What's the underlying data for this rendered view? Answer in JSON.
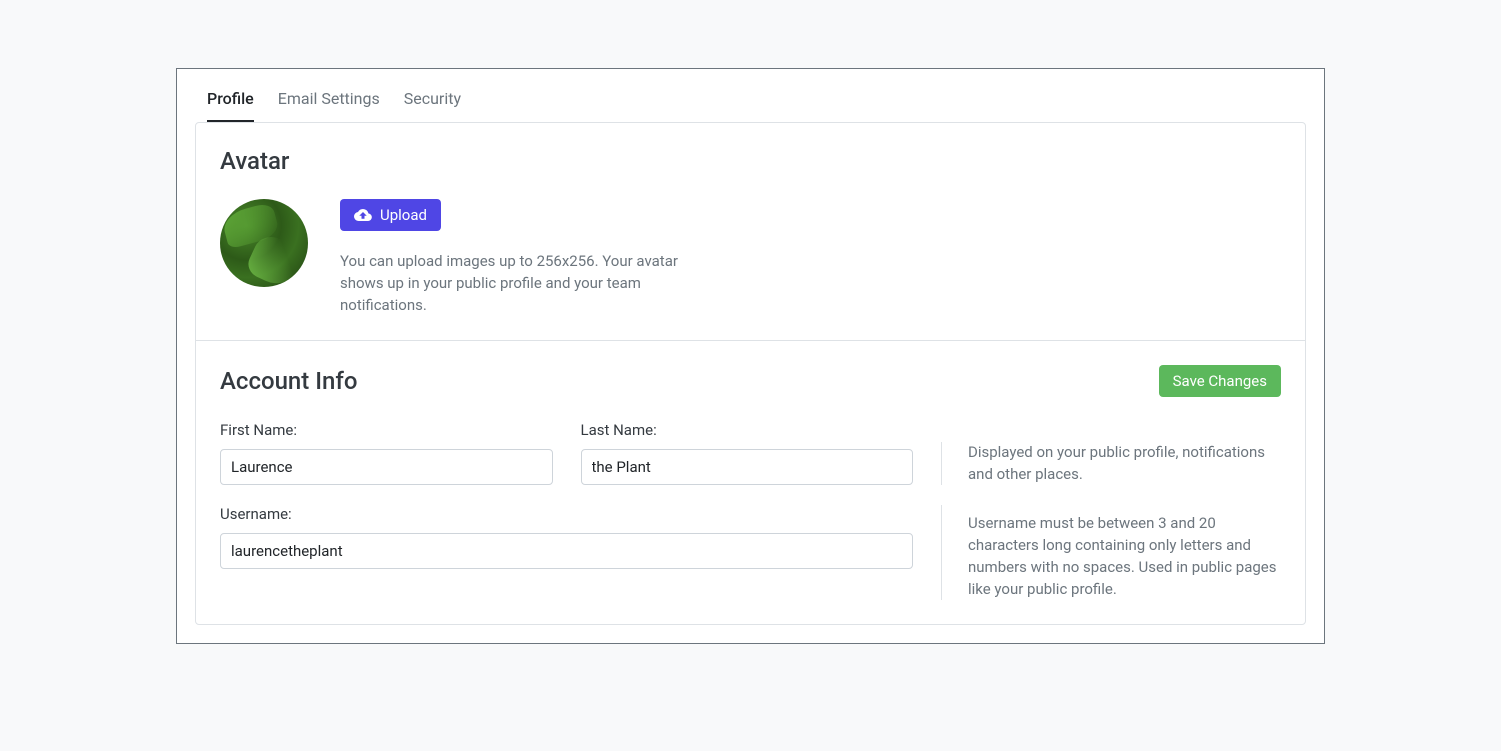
{
  "tabs": [
    {
      "label": "Profile",
      "active": true
    },
    {
      "label": "Email Settings",
      "active": false
    },
    {
      "label": "Security",
      "active": false
    }
  ],
  "avatar_section": {
    "title": "Avatar",
    "upload_label": "Upload",
    "help_text": "You can upload images up to 256x256. Your avatar shows up in your public profile and your team notifications."
  },
  "account_section": {
    "title": "Account Info",
    "save_label": "Save Changes",
    "fields": {
      "first_name": {
        "label": "First Name:",
        "value": "Laurence"
      },
      "last_name": {
        "label": "Last Name:",
        "value": "the Plant"
      },
      "username": {
        "label": "Username:",
        "value": "laurencetheplant"
      }
    },
    "hints": {
      "name": "Displayed on your public profile, notifications and other places.",
      "username": "Username must be between 3 and 20 characters long containing only letters and numbers with no spaces. Used in public pages like your public profile."
    }
  }
}
